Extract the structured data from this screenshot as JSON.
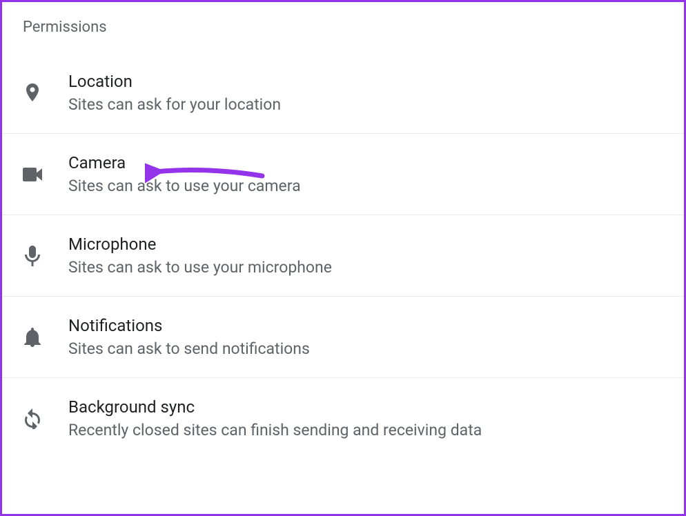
{
  "section": {
    "title": "Permissions"
  },
  "permissions": [
    {
      "id": "location",
      "title": "Location",
      "description": "Sites can ask for your location"
    },
    {
      "id": "camera",
      "title": "Camera",
      "description": "Sites can ask to use your camera"
    },
    {
      "id": "microphone",
      "title": "Microphone",
      "description": "Sites can ask to use your microphone"
    },
    {
      "id": "notifications",
      "title": "Notifications",
      "description": "Sites can ask to send notifications"
    },
    {
      "id": "background-sync",
      "title": "Background sync",
      "description": "Recently closed sites can finish sending and receiving data"
    }
  ],
  "annotation": {
    "target": "camera",
    "color": "#9333ea"
  }
}
